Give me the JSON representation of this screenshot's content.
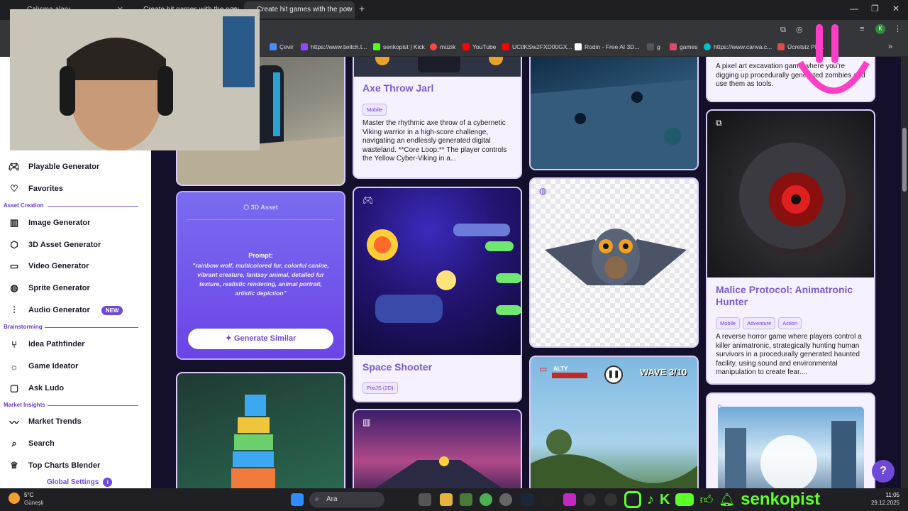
{
  "browser": {
    "tabs": [
      {
        "title": "Çalışma alanı"
      },
      {
        "title": "Create hit games with the pow"
      },
      {
        "title": "Create hit games with the pow"
      }
    ],
    "new_tab": "+",
    "bookmarks": [
      {
        "label": "Çevir",
        "color": "#4a8cff"
      },
      {
        "label": "https://www.twitch.t...",
        "color": "#9146ff"
      },
      {
        "label": "senkopist | Kick",
        "color": "#53fc18"
      },
      {
        "label": "müzik",
        "color": "#ff4444"
      },
      {
        "label": "YouTube",
        "color": "#ff0000"
      },
      {
        "label": "UCtlKSw2FXD00GX...",
        "color": "#ff0000"
      },
      {
        "label": "Rodin - Free AI 3D...",
        "color": "#ffffff"
      },
      {
        "label": "g",
        "color": "#333333"
      },
      {
        "label": "games",
        "color": "#e04a6a"
      },
      {
        "label": "https://www.canva.c...",
        "color": "#00c4cc"
      },
      {
        "label": "Ücretsiz PN...",
        "color": "#e04a4a"
      }
    ],
    "profile_initial": "K"
  },
  "sidebar": {
    "items_top": [
      {
        "label": "Playable Generator",
        "icon": "gamepad-icon"
      },
      {
        "label": "Favorites",
        "icon": "heart-icon"
      }
    ],
    "section_asset": "Asset Creation",
    "items_asset": [
      {
        "label": "Image Generator",
        "icon": "image-icon"
      },
      {
        "label": "3D Asset Generator",
        "icon": "cube-icon"
      },
      {
        "label": "Video Generator",
        "icon": "video-icon"
      },
      {
        "label": "Sprite Generator",
        "icon": "sprite-icon"
      },
      {
        "label": "Audio Generator",
        "icon": "audio-icon",
        "badge": "NEW"
      }
    ],
    "section_brain": "Brainstorming",
    "items_brain": [
      {
        "label": "Idea Pathfinder",
        "icon": "path-icon"
      },
      {
        "label": "Game Ideator",
        "icon": "bulb-icon"
      },
      {
        "label": "Ask Ludo",
        "icon": "chat-icon"
      }
    ],
    "section_market": "Market Insights",
    "items_market": [
      {
        "label": "Market Trends",
        "icon": "trend-icon"
      },
      {
        "label": "Search",
        "icon": "search-icon"
      },
      {
        "label": "Top Charts Blender",
        "icon": "trophy-icon"
      }
    ],
    "global_settings": "Global Settings",
    "global_badge": "i"
  },
  "cards": {
    "axe": {
      "title": "Axe Throw Jarl",
      "chips": [
        "Mobile"
      ],
      "desc": "Master the rhythmic axe throw of a cybernetic Viking warrior in a high-score challenge, navigating an endlessly generated digital wasteland. **Core Loop:** The player controls the Yellow Cyber-Viking in a..."
    },
    "asset3d": {
      "header": "3D Asset",
      "prompt_label": "Prompt:",
      "prompt": "\"rainbow wolf, multicolored fur, colorful canine, vibrant creature, fantasy animal, detailed fur texture, realistic rendering, animal portrait, artistic depiction\"",
      "button": "Generate Similar"
    },
    "space": {
      "title": "Space Shooter",
      "chips": [
        "PixiJS (2D)"
      ]
    },
    "pixel": {
      "desc": "A pixel art excavation game where you're digging up procedurally generated zombies and use them as tools."
    },
    "malice": {
      "title": "Malice Protocol: Animatronic Hunter",
      "chips": [
        "Mobile",
        "Adventure",
        "Action"
      ],
      "desc": "A reverse horror game where players control a killer animatronic, strategically hunting human survivors in a procedurally generated haunted facility, using sound and environmental manipulation to create fear...."
    },
    "wave": {
      "hud": "WAVE 3/10",
      "hp_label": "ALTY"
    }
  },
  "help_button": "?",
  "taskbar": {
    "weather_temp": "5°C",
    "weather_place": "Güneşli",
    "search": "Ara",
    "time": "11:05",
    "date": "29.12.2025",
    "stream_handle": "senkopist"
  },
  "colors": {
    "accent": "#6f49d8",
    "main_bg": "#140f2a",
    "card_bg": "#f6f1ff"
  }
}
